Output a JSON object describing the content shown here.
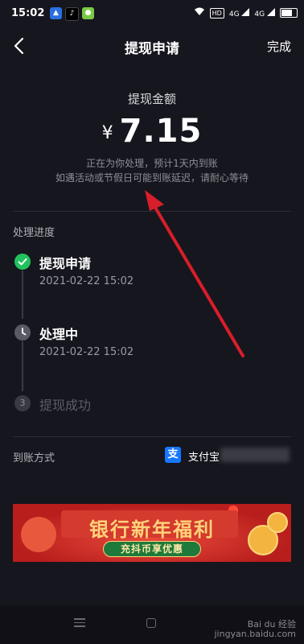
{
  "status_bar": {
    "time": "15:02",
    "hd_tag": "HD",
    "signal1": "4G",
    "signal2": "4G"
  },
  "nav": {
    "title": "提现申请",
    "done_label": "完成"
  },
  "withdraw": {
    "amount_label": "提现金额",
    "currency": "¥",
    "amount": "7.15",
    "notice_line1": "正在为你处理，预计1天内到账",
    "notice_line2": "如遇活动或节假日可能到账延迟，请耐心等待"
  },
  "progress": {
    "title": "处理进度",
    "steps": [
      {
        "label": "提现申请",
        "time": "2021-02-22 15:02",
        "state": "done"
      },
      {
        "label": "处理中",
        "time": "2021-02-22 15:02",
        "state": "in-progress"
      },
      {
        "number": "3",
        "label": "提现成功",
        "state": "pending"
      }
    ]
  },
  "payout": {
    "label": "到账方式",
    "method": "支付宝",
    "icon": "alipay-icon"
  },
  "banner": {
    "title": "银行新年福利",
    "subtitle": "充抖币享优惠"
  },
  "watermark": {
    "line1": "Bai du 经验",
    "line2": "jingyan.baidu.com"
  },
  "colors": {
    "background": "#16161e",
    "success_green": "#22c25f",
    "banner_red": "#c22a25",
    "annotation_arrow": "#d81e2a"
  }
}
